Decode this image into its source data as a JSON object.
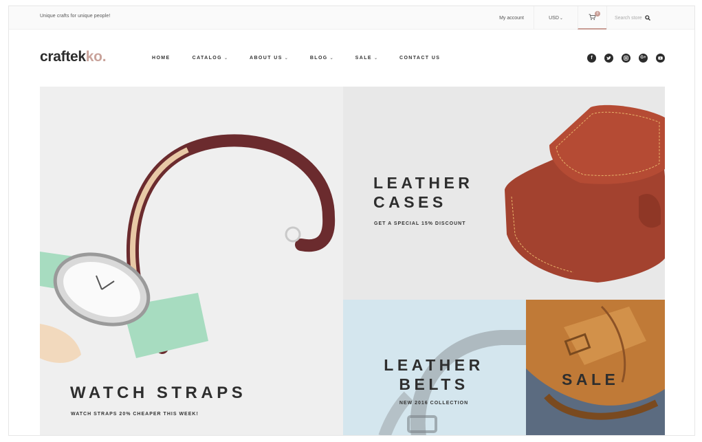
{
  "topbar": {
    "tagline": "Unique crafts for unique people!",
    "account": "My account",
    "currency": "USD",
    "cart_count": "0",
    "search_placeholder": "Search store"
  },
  "header": {
    "logo_main": "craftek",
    "logo_accent": "ko.",
    "nav": [
      {
        "label": "HOME",
        "has_dropdown": false
      },
      {
        "label": "CATALOG",
        "has_dropdown": true
      },
      {
        "label": "ABOUT US",
        "has_dropdown": true
      },
      {
        "label": "BLOG",
        "has_dropdown": true
      },
      {
        "label": "SALE",
        "has_dropdown": true
      },
      {
        "label": "CONTACT US",
        "has_dropdown": false
      }
    ],
    "social": [
      "facebook-icon",
      "twitter-icon",
      "instagram-icon",
      "google-plus-icon",
      "youtube-icon"
    ]
  },
  "banners": {
    "watch": {
      "title": "WATCH STRAPS",
      "subtitle": "WATCH STRAPS 20% CHEAPER THIS WEEK!"
    },
    "cases": {
      "title_line1": "LEATHER",
      "title_line2": "CASES",
      "subtitle": "GET A SPECIAL 15% DISCOUNT"
    },
    "belts": {
      "title_line1": "LEATHER",
      "title_line2": "BELTS",
      "subtitle": "NEW 2016 COLLECTION"
    },
    "sale": {
      "title": "SALE"
    }
  },
  "colors": {
    "accent": "#c9a39b",
    "text": "#2e2e2e",
    "belts_bg": "#d4e6ee"
  }
}
